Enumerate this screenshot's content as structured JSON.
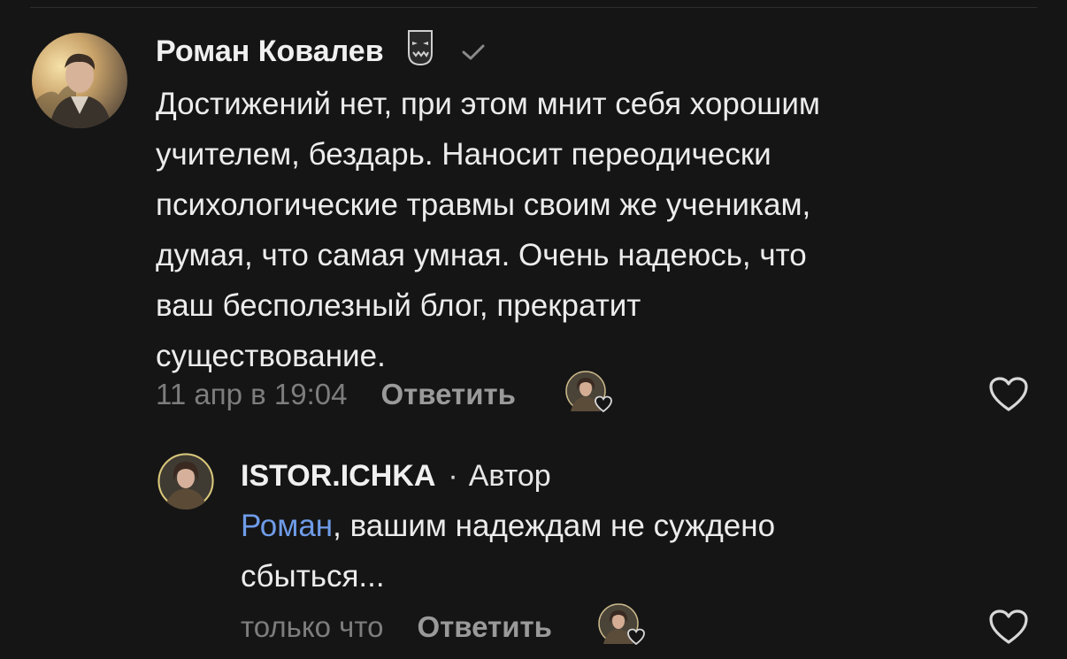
{
  "comment": {
    "author": "Роман Ковалев",
    "badge_icon": "mask-icon",
    "verified_icon": "check-icon",
    "text_lines": [
      "Достижений нет, при этом мнит себя хорошим",
      "учителем, бездарь. Наносит переодически",
      "психологические травмы своим же ученикам,",
      "думая, что самая умная. Очень надеюсь, что",
      "ваш бесполезный блог, прекратит",
      "существование."
    ],
    "time": "11 апр в 19:04",
    "reply_label": "Ответить",
    "like_icon": "heart-icon"
  },
  "reply": {
    "author": "ISTOR.ICHKA",
    "separator": "·",
    "role": "Автор",
    "mention": "Роман",
    "text_line1_rest": ", вашим надеждам не суждено",
    "text_line2": "сбыться...",
    "time": "только что",
    "reply_label": "Ответить",
    "like_icon": "heart-icon"
  },
  "colors": {
    "background": "#151515",
    "text": "#ececec",
    "muted": "#7d7d7d",
    "mention": "#6f9ce9"
  }
}
